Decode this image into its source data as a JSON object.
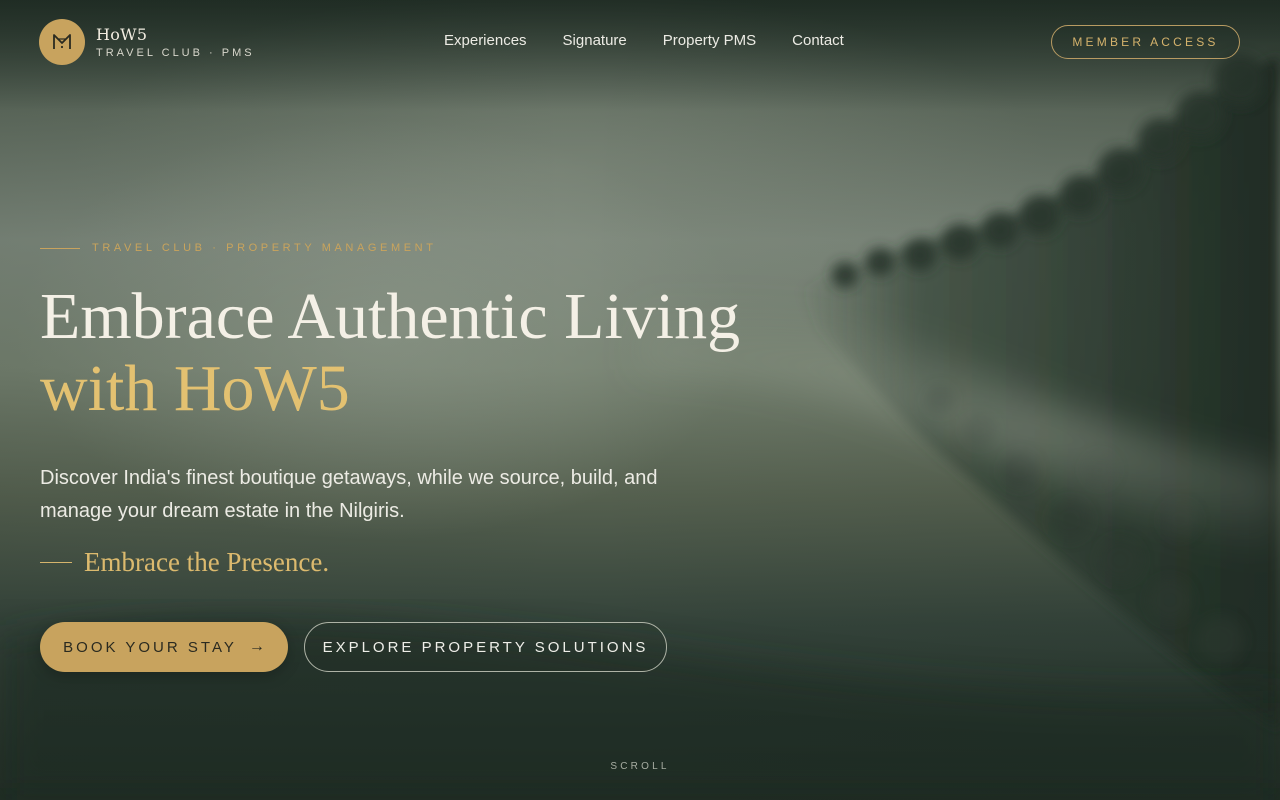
{
  "header": {
    "brand_name": "HoW5",
    "brand_sub": "TRAVEL CLUB · PMS",
    "logo_monogram": "M",
    "nav": [
      {
        "label": "Experiences"
      },
      {
        "label": "Signature"
      },
      {
        "label": "Property PMS"
      },
      {
        "label": "Contact"
      }
    ],
    "member_label": "MEMBER ACCESS"
  },
  "hero": {
    "eyebrow": "TRAVEL CLUB · PROPERTY MANAGEMENT",
    "title_line1": "Embrace Authentic Living",
    "title_line2_prefix": "with ",
    "title_line2_brand": "HoW5",
    "description": "Discover India's finest boutique getaways, while we source, build, and manage your dream estate in the Nilgiris.",
    "tagline": "Embrace the Presence.",
    "book_label": "BOOK YOUR STAY",
    "book_arrow": "→",
    "explore_label": "EXPLORE PROPERTY SOLUTIONS",
    "scroll_label": "SCROLL"
  },
  "icons": {
    "logo": "monogram-logo-icon",
    "arrow": "arrow-right-icon"
  },
  "colors": {
    "accent_gold": "#c8a35e",
    "headline_gold": "#e3c171",
    "forest_dark": "#1f2a22"
  }
}
